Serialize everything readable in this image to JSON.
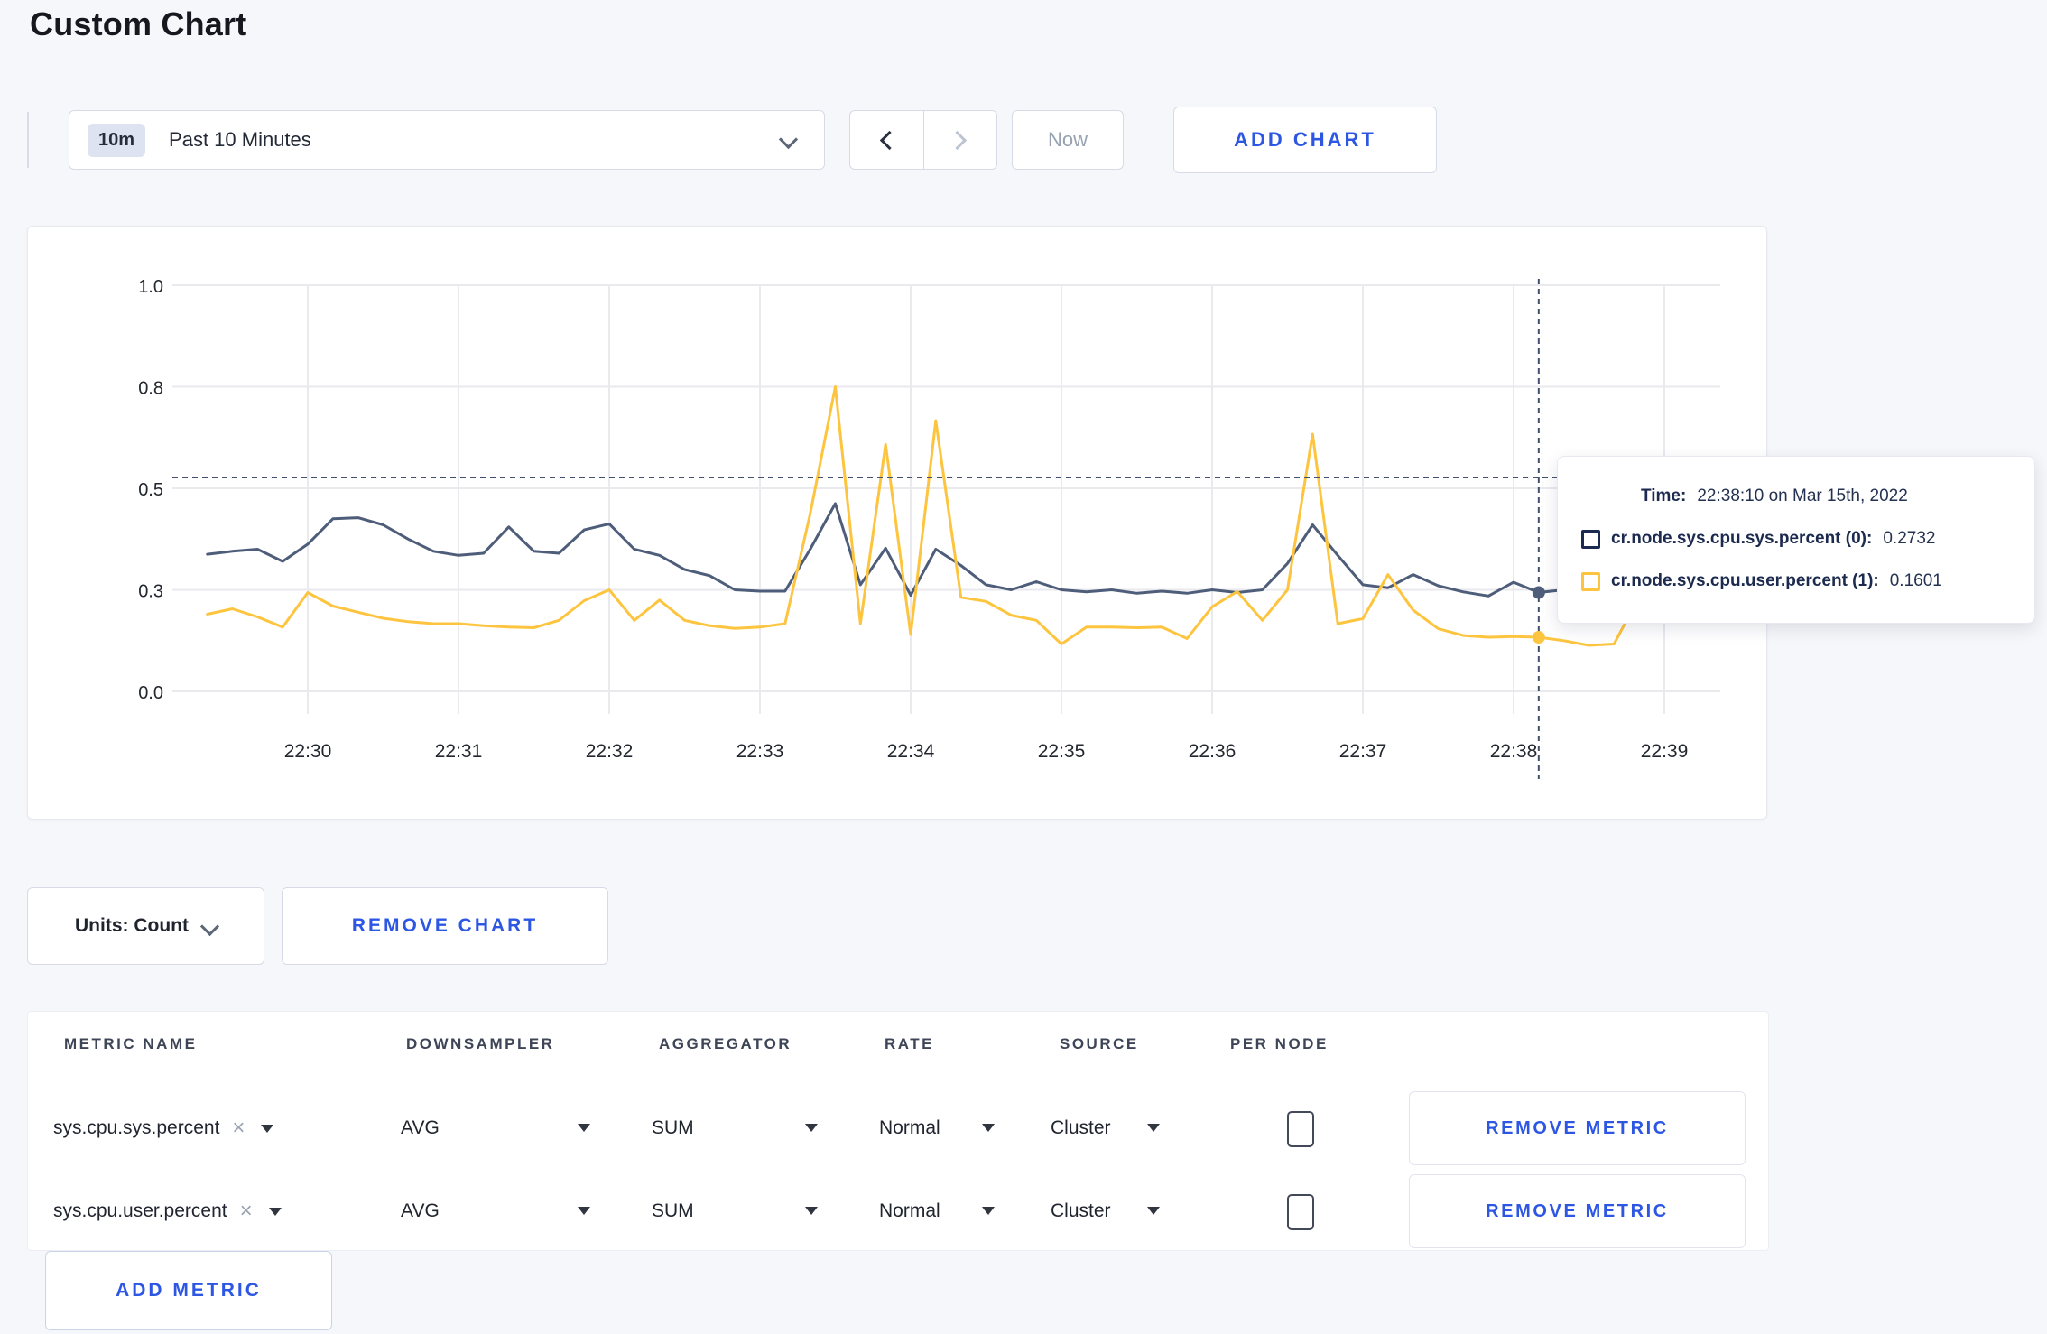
{
  "page": {
    "title": "Custom Chart"
  },
  "toolbar": {
    "time_range": {
      "badge": "10m",
      "label": "Past 10 Minutes"
    },
    "now_label": "Now",
    "add_chart_label": "ADD CHART"
  },
  "units": {
    "label": "Units: Count",
    "remove_chart_label": "REMOVE CHART"
  },
  "tooltip": {
    "time_label": "Time:",
    "time_value": "22:38:10 on Mar 15th, 2022",
    "entries": [
      {
        "label": "cr.node.sys.cpu.sys.percent (0):",
        "value": "0.2732",
        "color": "#1b2a4e"
      },
      {
        "label": "cr.node.sys.cpu.user.percent (1):",
        "value": "0.1601",
        "color": "#fdc53f"
      }
    ]
  },
  "chart_data": {
    "type": "line",
    "title": "",
    "xlabel": "",
    "ylabel": "",
    "grid": true,
    "legend_position": "tooltip",
    "x_axis": {
      "ticks": [
        "22:30",
        "22:31",
        "22:32",
        "22:33",
        "22:34",
        "22:35",
        "22:36",
        "22:37",
        "22:38",
        "22:39"
      ]
    },
    "y_axis": {
      "ticks": [
        0,
        0.3,
        0.5,
        0.8,
        1.0
      ],
      "tick_labels": [
        "0.0",
        "0.3",
        "0.5",
        "0.8",
        "1.0"
      ],
      "ylim": [
        0,
        1.0
      ]
    },
    "start_time": "22:29:20",
    "interval_sec": 10,
    "series": [
      {
        "name": "cr.node.sys.cpu.sys.percent",
        "color": "#4e5d79",
        "values": [
          0.37,
          0.376,
          0.38,
          0.356,
          0.39,
          0.44,
          0.442,
          0.428,
          0.4,
          0.376,
          0.368,
          0.372,
          0.424,
          0.376,
          0.372,
          0.418,
          0.43,
          0.38,
          0.368,
          0.34,
          0.328,
          0.3,
          0.296,
          0.296,
          0.38,
          0.47,
          0.31,
          0.382,
          0.284,
          0.38,
          0.348,
          0.31,
          0.3,
          0.316,
          0.3,
          0.294,
          0.3,
          0.29,
          0.296,
          0.29,
          0.3,
          0.292,
          0.3,
          0.352,
          0.428,
          0.368,
          0.31,
          0.304,
          0.33,
          0.308,
          0.294,
          0.282,
          0.315,
          0.292,
          0.3,
          0.29,
          0.296,
          0.3,
          0.298,
          0.3
        ]
      },
      {
        "name": "cr.node.sys.cpu.user.percent",
        "color": "#fdc53f",
        "values": [
          0.228,
          0.244,
          0.22,
          0.19,
          0.292,
          0.252,
          0.234,
          0.216,
          0.206,
          0.2,
          0.2,
          0.194,
          0.19,
          0.188,
          0.21,
          0.268,
          0.3,
          0.21,
          0.27,
          0.21,
          0.194,
          0.186,
          0.19,
          0.2,
          0.45,
          0.8,
          0.2,
          0.63,
          0.168,
          0.7,
          0.278,
          0.266,
          0.225,
          0.21,
          0.14,
          0.19,
          0.19,
          0.188,
          0.19,
          0.156,
          0.25,
          0.295,
          0.21,
          0.3,
          0.66,
          0.2,
          0.215,
          0.33,
          0.24,
          0.185,
          0.165,
          0.16,
          0.162,
          0.16,
          0.15,
          0.136,
          0.14,
          0.28,
          0.248,
          0.215
        ]
      }
    ],
    "hover": {
      "time": "22:38:10",
      "line_value": 0.532,
      "points": [
        0.292,
        0.16
      ]
    }
  },
  "metrics_table": {
    "headers": [
      "METRIC NAME",
      "DOWNSAMPLER",
      "AGGREGATOR",
      "RATE",
      "SOURCE",
      "PER NODE"
    ],
    "rows": [
      {
        "metric": "sys.cpu.sys.percent",
        "downsampler": "AVG",
        "aggregator": "SUM",
        "rate": "Normal",
        "source": "Cluster",
        "per_node_checked": false,
        "remove_label": "REMOVE METRIC"
      },
      {
        "metric": "sys.cpu.user.percent",
        "downsampler": "AVG",
        "aggregator": "SUM",
        "rate": "Normal",
        "source": "Cluster",
        "per_node_checked": false,
        "remove_label": "REMOVE METRIC"
      }
    ],
    "add_metric_label": "ADD METRIC"
  }
}
